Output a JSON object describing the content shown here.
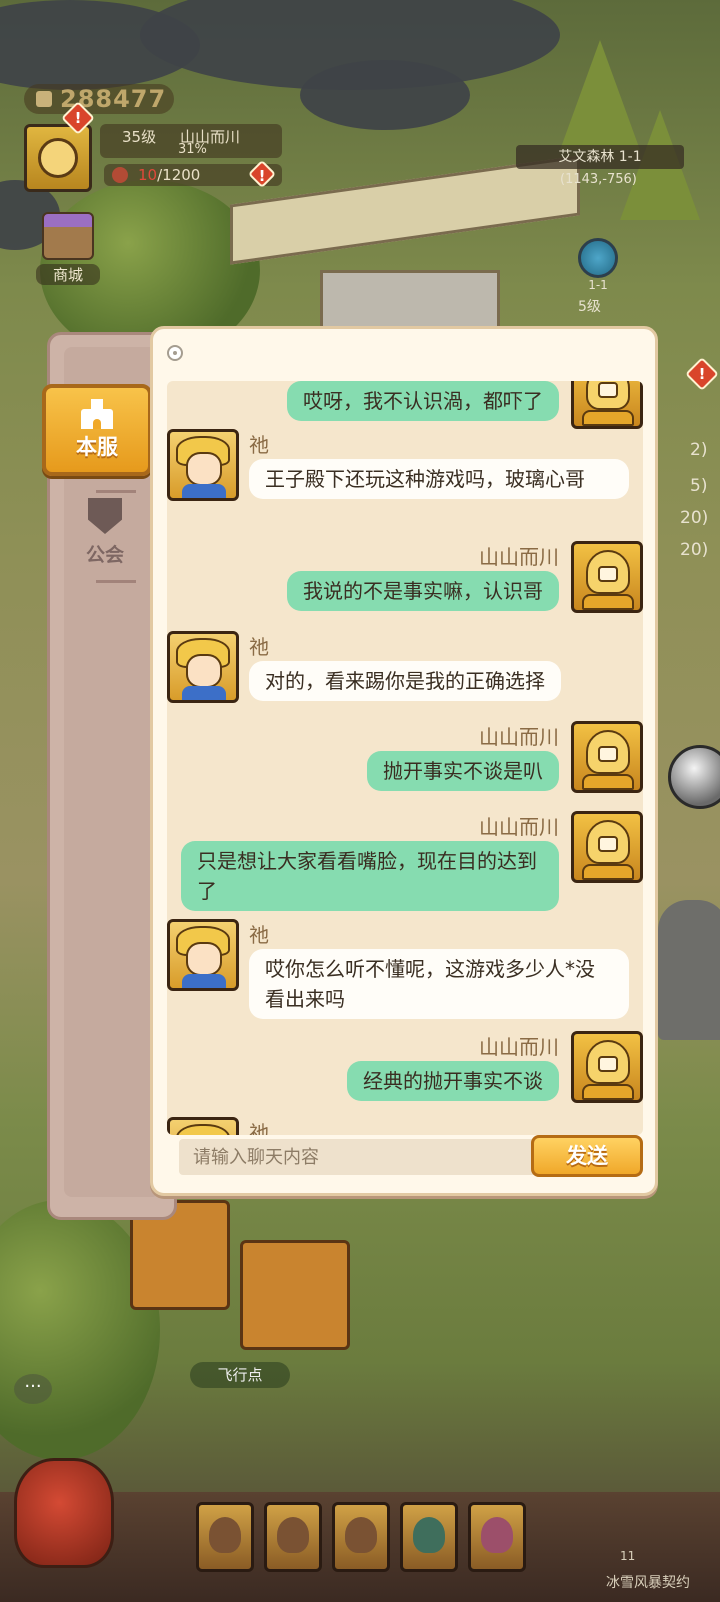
{
  "hud": {
    "gold": "288477",
    "level": "35级",
    "player_name": "山山而川",
    "exp_percent": "31%",
    "food_current": "10",
    "food_max": "/1200",
    "shop_label": "商城"
  },
  "map": {
    "area_name": "艾文森林 1-1",
    "coordinates": "(1143,-756)",
    "node_stage": "1-1",
    "node_level": "5级",
    "flight_point": "飞行点"
  },
  "side_numbers": [
    "2)",
    "5)",
    "20)",
    "20)"
  ],
  "tabs": {
    "server": "本服",
    "guild": "公会"
  },
  "chat": {
    "partial_top": "哎呀，我不认识渦，都吓了",
    "messages": [
      {
        "side": "other",
        "name": "祂",
        "text": "王子殿下还玩这种游戏吗，玻璃心哥"
      },
      {
        "side": "self",
        "name": "山山而川",
        "text": "我说的不是事实嘛，认识哥"
      },
      {
        "side": "other",
        "name": "祂",
        "text": "对的，看来踢你是我的正确选择"
      },
      {
        "side": "self",
        "name": "山山而川",
        "text": "抛开事实不谈是叭"
      },
      {
        "side": "self",
        "name": "山山而川",
        "text": "只是想让大家看看嘴脸，现在目的达到了"
      },
      {
        "side": "other",
        "name": "祂",
        "text": "哎你怎么听不懂呢，这游戏多少人*没看出来吗"
      },
      {
        "side": "self",
        "name": "山山而川",
        "text": "经典的抛开事实不谈"
      }
    ],
    "partial_bottom_name": "祂",
    "input_placeholder": "请输入聊天内容",
    "send_label": "发送"
  },
  "bottom": {
    "count": "11",
    "event_text": "冰雪风暴契约"
  },
  "colors": {
    "self_bubble": "#86dcb0",
    "other_bubble": "#fffdf8",
    "send_button": "#f0a82a",
    "tab_active": "#f8c34a"
  }
}
